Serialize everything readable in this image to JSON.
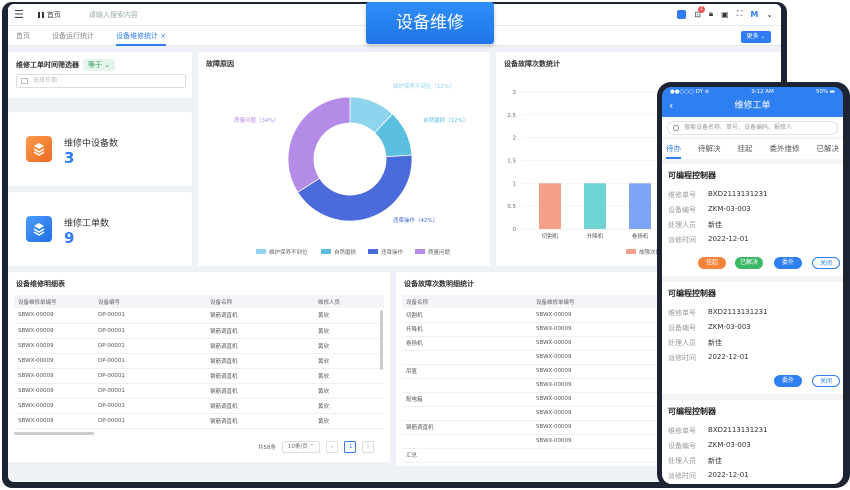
{
  "banner": "设备维修",
  "topbar": {
    "home": "首页",
    "search_placeholder": "请输入搜索内容"
  },
  "tabs": [
    {
      "label": "首页"
    },
    {
      "label": "设备运行统计"
    },
    {
      "label": "设备维修统计",
      "close": "×"
    }
  ],
  "more_button": "更多 ⌄",
  "filter": {
    "title": "维修工单时间筛选器",
    "range": "today 等于 ⌄",
    "range_text": "等于 ⌄",
    "date_placeholder": "选择日期"
  },
  "stats": [
    {
      "label": "维修中设备数",
      "value": "3",
      "color": "#f0782a"
    },
    {
      "label": "维修工单数",
      "value": "9",
      "color": "#2f7cf6"
    }
  ],
  "donut": {
    "title": "故障原因",
    "slices": [
      {
        "name": "维护保养不到位",
        "value": 12,
        "label": "维护保养不到位（12%）",
        "color": "#8ed4ef"
      },
      {
        "name": "自然磨损",
        "value": 12,
        "label": "自然磨损（12%）",
        "color": "#5bbfe0"
      },
      {
        "name": "违章操作",
        "value": 42,
        "label": "违章操作（42%）",
        "color": "#4a6bd9"
      },
      {
        "name": "质量问题",
        "value": 34,
        "label": "质量问题（34%）",
        "color": "#b48ce8"
      }
    ]
  },
  "bar": {
    "title": "设备故障次数统计",
    "yticks": [
      "0",
      "0.5",
      "1",
      "1.5",
      "2",
      "2.5",
      "3"
    ],
    "categories": [
      "切割机",
      "升降机",
      "卷扬机"
    ],
    "values": [
      1,
      1,
      1
    ],
    "colors": [
      "#f4a08b",
      "#6fd4d4",
      "#7fa3f4"
    ],
    "legend": "故障次数"
  },
  "repair_table": {
    "title": "设备维修明细表",
    "headers": [
      "设备维修单编号",
      "设备编号",
      "设备名称",
      "维修人员"
    ],
    "rows": [
      [
        "SBWX-00009",
        "DP-00001",
        "钢筋调直机",
        "黄欣"
      ],
      [
        "SBWX-00009",
        "DP-00001",
        "钢筋调直机",
        "黄欣"
      ],
      [
        "SBWX-00009",
        "DP-00001",
        "钢筋调直机",
        "黄欣"
      ],
      [
        "SBWX-00009",
        "DP-00001",
        "钢筋调直机",
        "黄欣"
      ],
      [
        "SBWX-00009",
        "DP-00001",
        "钢筋调直机",
        "黄欣"
      ],
      [
        "SBWX-00009",
        "DP-00001",
        "钢筋调直机",
        "黄欣"
      ],
      [
        "SBWX-00009",
        "DP-00001",
        "钢筋调直机",
        "黄欣"
      ],
      [
        "SBWX-00009",
        "DP-00001",
        "钢筋调直机",
        "黄欣"
      ]
    ],
    "total": "共58条",
    "page_size": "10条/页 ⌃",
    "page": "1",
    "prev": "‹",
    "next": "›"
  },
  "fault_table": {
    "title": "设备故障次数明细统计",
    "headers": [
      "设备名称",
      "设备维修单编号"
    ],
    "rows": [
      [
        "切割机",
        "SBWX-00009"
      ],
      [
        "升降机",
        "SBWX-00009"
      ],
      [
        "卷扬机",
        "SBWX-00009"
      ],
      [
        "",
        "SBWX-00009"
      ],
      [
        "吊篮",
        "SBWX-00009"
      ],
      [
        "",
        "SBWX-00009"
      ],
      [
        "配电箱",
        "SBWX-00009"
      ],
      [
        "",
        "SBWX-00009"
      ],
      [
        "钢筋调直机",
        "SBWX-00009"
      ],
      [
        "",
        "SBWX-00009"
      ],
      [
        "汇总",
        ""
      ]
    ]
  },
  "phone": {
    "status_left": "●●○○○ DY  ≋",
    "status_time": "9:12 AM",
    "status_right": "50% ▬",
    "title": "维修工单",
    "search_placeholder": "搜索设备名称、单号、设备编码、报修人",
    "tabs": [
      "待办",
      "待解决",
      "挂起",
      "委外维修",
      "已解决"
    ],
    "labels": {
      "order": "维修单号",
      "code": "设备编号",
      "handler": "处理人员",
      "time": "派修时间"
    },
    "cards": [
      {
        "title": "可编程控制器",
        "order": "BXD2113131231",
        "code": "ZKM-03-003",
        "handler": "新佳",
        "time": "2022-12-01"
      },
      {
        "title": "可编程控制器",
        "order": "BXD2113131231",
        "code": "ZKM-03-003",
        "handler": "新佳",
        "time": "2022-12-01"
      },
      {
        "title": "可编程控制器",
        "order": "BXD2113131231",
        "code": "ZKM-03-003",
        "handler": "新佳",
        "time": "2022-12-01"
      }
    ],
    "btn_hang": "挂起",
    "btn_solved": "已解决",
    "btn_outsource": "委外",
    "btn_close": "关闭"
  }
}
